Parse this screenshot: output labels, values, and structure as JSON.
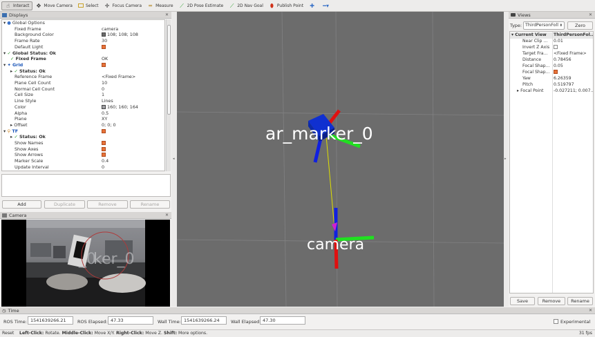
{
  "toolbar": {
    "tools": [
      {
        "label": "Interact",
        "icon": "interact-icon"
      },
      {
        "label": "Move Camera",
        "icon": "move-camera-icon"
      },
      {
        "label": "Select",
        "icon": "select-icon"
      },
      {
        "label": "Focus Camera",
        "icon": "focus-camera-icon"
      },
      {
        "label": "Measure",
        "icon": "measure-icon"
      },
      {
        "label": "2D Pose Estimate",
        "icon": "pose-estimate-icon"
      },
      {
        "label": "2D Nav Goal",
        "icon": "nav-goal-icon"
      },
      {
        "label": "Publish Point",
        "icon": "publish-point-icon"
      }
    ]
  },
  "displays": {
    "title": "Displays",
    "rows": [
      {
        "label": "Global Options",
        "value": ""
      },
      {
        "label": "Fixed Frame",
        "value": "camera"
      },
      {
        "label": "Background Color",
        "value": "108; 108; 108"
      },
      {
        "label": "Frame Rate",
        "value": "30"
      },
      {
        "label": "Default Light",
        "value": ""
      },
      {
        "label": "Global Status: Ok",
        "value": ""
      },
      {
        "label": "Fixed Frame",
        "value": "OK"
      },
      {
        "label": "Grid",
        "value": ""
      },
      {
        "label": "Status: Ok",
        "value": ""
      },
      {
        "label": "Reference Frame",
        "value": "<Fixed Frame>"
      },
      {
        "label": "Plane Cell Count",
        "value": "10"
      },
      {
        "label": "Normal Cell Count",
        "value": "0"
      },
      {
        "label": "Cell Size",
        "value": "1"
      },
      {
        "label": "Line Style",
        "value": "Lines"
      },
      {
        "label": "Color",
        "value": "160; 160; 164"
      },
      {
        "label": "Alpha",
        "value": "0.5"
      },
      {
        "label": "Plane",
        "value": "XY"
      },
      {
        "label": "Offset",
        "value": "0; 0; 0"
      },
      {
        "label": "TF",
        "value": ""
      },
      {
        "label": "Status: Ok",
        "value": ""
      },
      {
        "label": "Show Names",
        "value": ""
      },
      {
        "label": "Show Axes",
        "value": ""
      },
      {
        "label": "Show Arrows",
        "value": ""
      },
      {
        "label": "Marker Scale",
        "value": "0.4"
      },
      {
        "label": "Update Interval",
        "value": "0"
      }
    ],
    "buttons": {
      "add": "Add",
      "duplicate": "Duplicate",
      "remove": "Remove",
      "rename": "Rename"
    }
  },
  "camera_panel": {
    "title": "Camera"
  },
  "viewport": {
    "labels": {
      "marker": "ar_marker_0",
      "camera": "camera"
    }
  },
  "views": {
    "title": "Views",
    "type_label": "Type:",
    "type_value": "ThirdPersonFoll",
    "zero_label": "Zero",
    "header": {
      "label": "Current View",
      "value": "ThirdPersonFol..."
    },
    "rows": [
      {
        "label": "Near Clip ...",
        "value": "0.01"
      },
      {
        "label": "Invert Z Axis",
        "value": ""
      },
      {
        "label": "Target Fra...",
        "value": "<Fixed Frame>"
      },
      {
        "label": "Distance",
        "value": "0.78456"
      },
      {
        "label": "Focal Shap...",
        "value": "0.05"
      },
      {
        "label": "Focal Shap...",
        "value": ""
      },
      {
        "label": "Yaw",
        "value": "6.26359"
      },
      {
        "label": "Pitch",
        "value": "0.519797"
      },
      {
        "label": "Focal Point",
        "value": "-0.027211; 0.007..."
      }
    ],
    "buttons": {
      "save": "Save",
      "remove": "Remove",
      "rename": "Rename"
    }
  },
  "time": {
    "title": "Time",
    "ros_time_label": "ROS Time:",
    "ros_time": "1541639266.21",
    "ros_elapsed_label": "ROS Elapsed:",
    "ros_elapsed": "47.33",
    "wall_time_label": "Wall Time:",
    "wall_time": "1541639266.24",
    "wall_elapsed_label": "Wall Elapsed:",
    "wall_elapsed": "47.30",
    "experimental_label": "Experimental"
  },
  "status": {
    "reset": "Reset",
    "left_click": "Left-Click:",
    "left_desc": "Rotate.",
    "middle_click": "Middle-Click:",
    "middle_desc": "Move X/Y.",
    "right_click": "Right-Click:",
    "right_desc": "Move Z.",
    "shift": "Shift:",
    "shift_desc": "More options.",
    "fps": "31 fps"
  },
  "colors": {
    "bg_grey": "#6c6c6c",
    "grid_color": "#a0a0a4",
    "check_orange": "#e8733a"
  }
}
